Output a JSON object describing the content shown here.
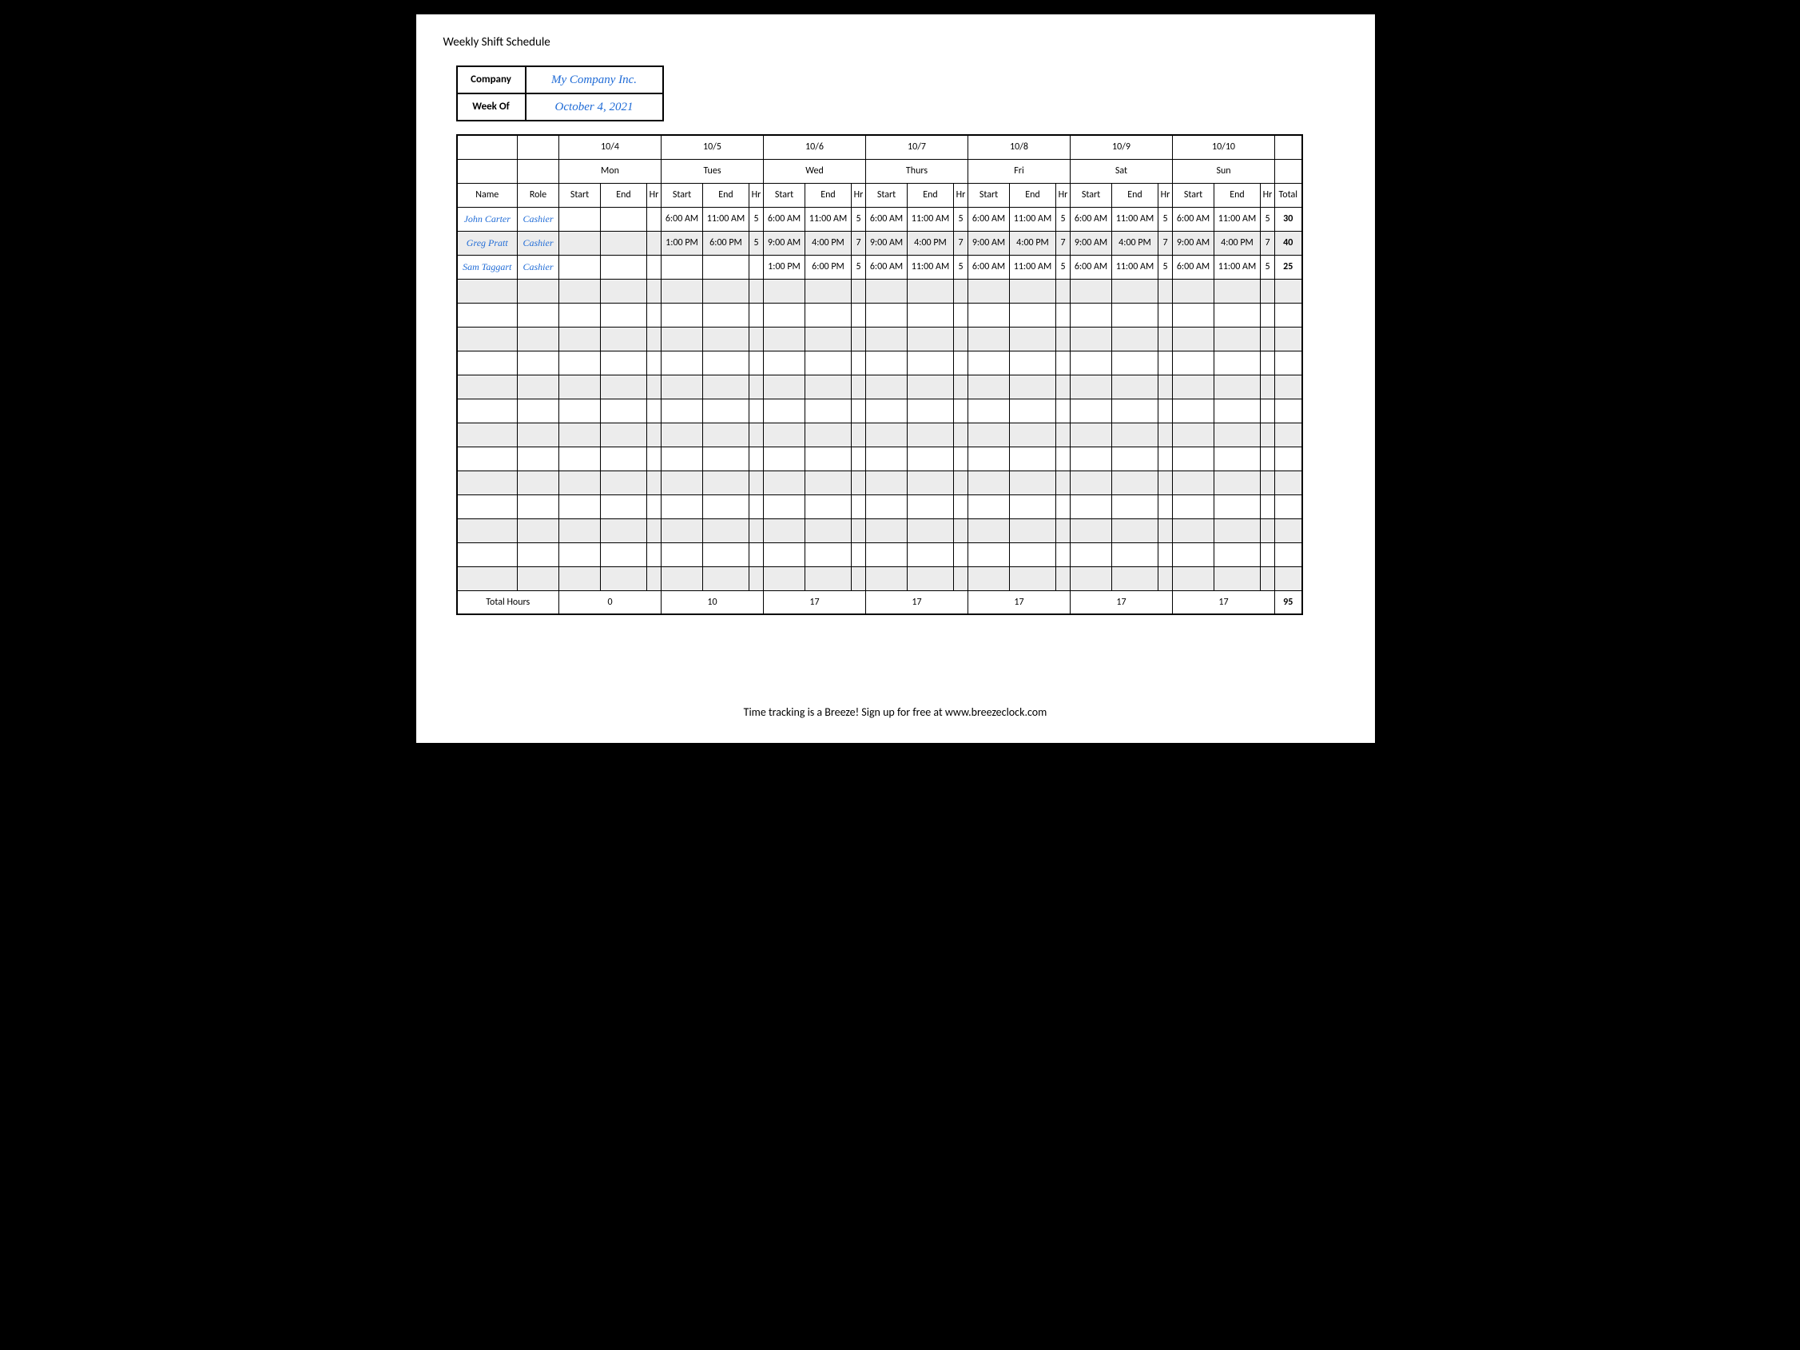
{
  "title": "Weekly Shift Schedule",
  "meta": {
    "company_label": "Company",
    "company_value": "My Company Inc.",
    "week_label": "Week Of",
    "week_value": "October 4, 2021"
  },
  "footer": "Time tracking is a Breeze! Sign up for free at www.breezeclock.com",
  "columns": {
    "name": "Name",
    "role": "Role",
    "start": "Start",
    "end": "End",
    "hr": "Hr",
    "total": "Total",
    "total_hours": "Total Hours"
  },
  "days": [
    {
      "date": "10/4",
      "day": "Mon"
    },
    {
      "date": "10/5",
      "day": "Tues"
    },
    {
      "date": "10/6",
      "day": "Wed"
    },
    {
      "date": "10/7",
      "day": "Thurs"
    },
    {
      "date": "10/8",
      "day": "Fri"
    },
    {
      "date": "10/9",
      "day": "Sat"
    },
    {
      "date": "10/10",
      "day": "Sun"
    }
  ],
  "day_totals": [
    "0",
    "10",
    "17",
    "17",
    "17",
    "17",
    "17"
  ],
  "grand_total": "95",
  "employees": [
    {
      "name": "John Carter",
      "role": "Cashier",
      "total": "30",
      "shifts": [
        {
          "start": "",
          "end": "",
          "hr": ""
        },
        {
          "start": "6:00 AM",
          "end": "11:00 AM",
          "hr": "5"
        },
        {
          "start": "6:00 AM",
          "end": "11:00 AM",
          "hr": "5"
        },
        {
          "start": "6:00 AM",
          "end": "11:00 AM",
          "hr": "5"
        },
        {
          "start": "6:00 AM",
          "end": "11:00 AM",
          "hr": "5"
        },
        {
          "start": "6:00 AM",
          "end": "11:00 AM",
          "hr": "5"
        },
        {
          "start": "6:00 AM",
          "end": "11:00 AM",
          "hr": "5"
        }
      ]
    },
    {
      "name": "Greg Pratt",
      "role": "Cashier",
      "total": "40",
      "shifts": [
        {
          "start": "",
          "end": "",
          "hr": ""
        },
        {
          "start": "1:00 PM",
          "end": "6:00 PM",
          "hr": "5"
        },
        {
          "start": "9:00 AM",
          "end": "4:00 PM",
          "hr": "7"
        },
        {
          "start": "9:00 AM",
          "end": "4:00 PM",
          "hr": "7"
        },
        {
          "start": "9:00 AM",
          "end": "4:00 PM",
          "hr": "7"
        },
        {
          "start": "9:00 AM",
          "end": "4:00 PM",
          "hr": "7"
        },
        {
          "start": "9:00 AM",
          "end": "4:00 PM",
          "hr": "7"
        }
      ]
    },
    {
      "name": "Sam Taggart",
      "role": "Cashier",
      "total": "25",
      "shifts": [
        {
          "start": "",
          "end": "",
          "hr": ""
        },
        {
          "start": "",
          "end": "",
          "hr": ""
        },
        {
          "start": "1:00 PM",
          "end": "6:00 PM",
          "hr": "5"
        },
        {
          "start": "6:00 AM",
          "end": "11:00 AM",
          "hr": "5"
        },
        {
          "start": "6:00 AM",
          "end": "11:00 AM",
          "hr": "5"
        },
        {
          "start": "6:00 AM",
          "end": "11:00 AM",
          "hr": "5"
        },
        {
          "start": "6:00 AM",
          "end": "11:00 AM",
          "hr": "5"
        }
      ]
    }
  ],
  "blank_rows": 13
}
